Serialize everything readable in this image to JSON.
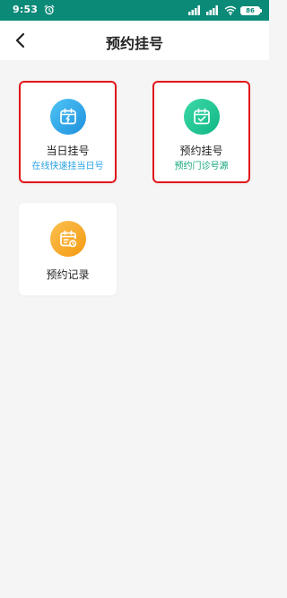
{
  "status_bar": {
    "time": "9:53",
    "battery": "86",
    "colors": {
      "background": "#0b8a78"
    },
    "icons": [
      "alarm-icon",
      "signal-icon",
      "signal-icon",
      "wifi-icon",
      "battery-icon"
    ]
  },
  "header": {
    "title": "预约挂号",
    "back_icon": "chevron-left-icon"
  },
  "cards": [
    {
      "title": "当日挂号",
      "subtitle": "在线快速挂当日号",
      "icon": "calendar-lightning-icon",
      "accent": "#2aa3e6",
      "subtitle_color": "#2aa3e6",
      "highlighted": true
    },
    {
      "title": "预约挂号",
      "subtitle": "预约门诊号源",
      "icon": "calendar-check-icon",
      "accent": "#12c08c",
      "subtitle_color": "#12a57a",
      "highlighted": true
    },
    {
      "title": "预约记录",
      "icon": "calendar-clock-icon",
      "accent": "#f7a823",
      "highlighted": false
    }
  ]
}
